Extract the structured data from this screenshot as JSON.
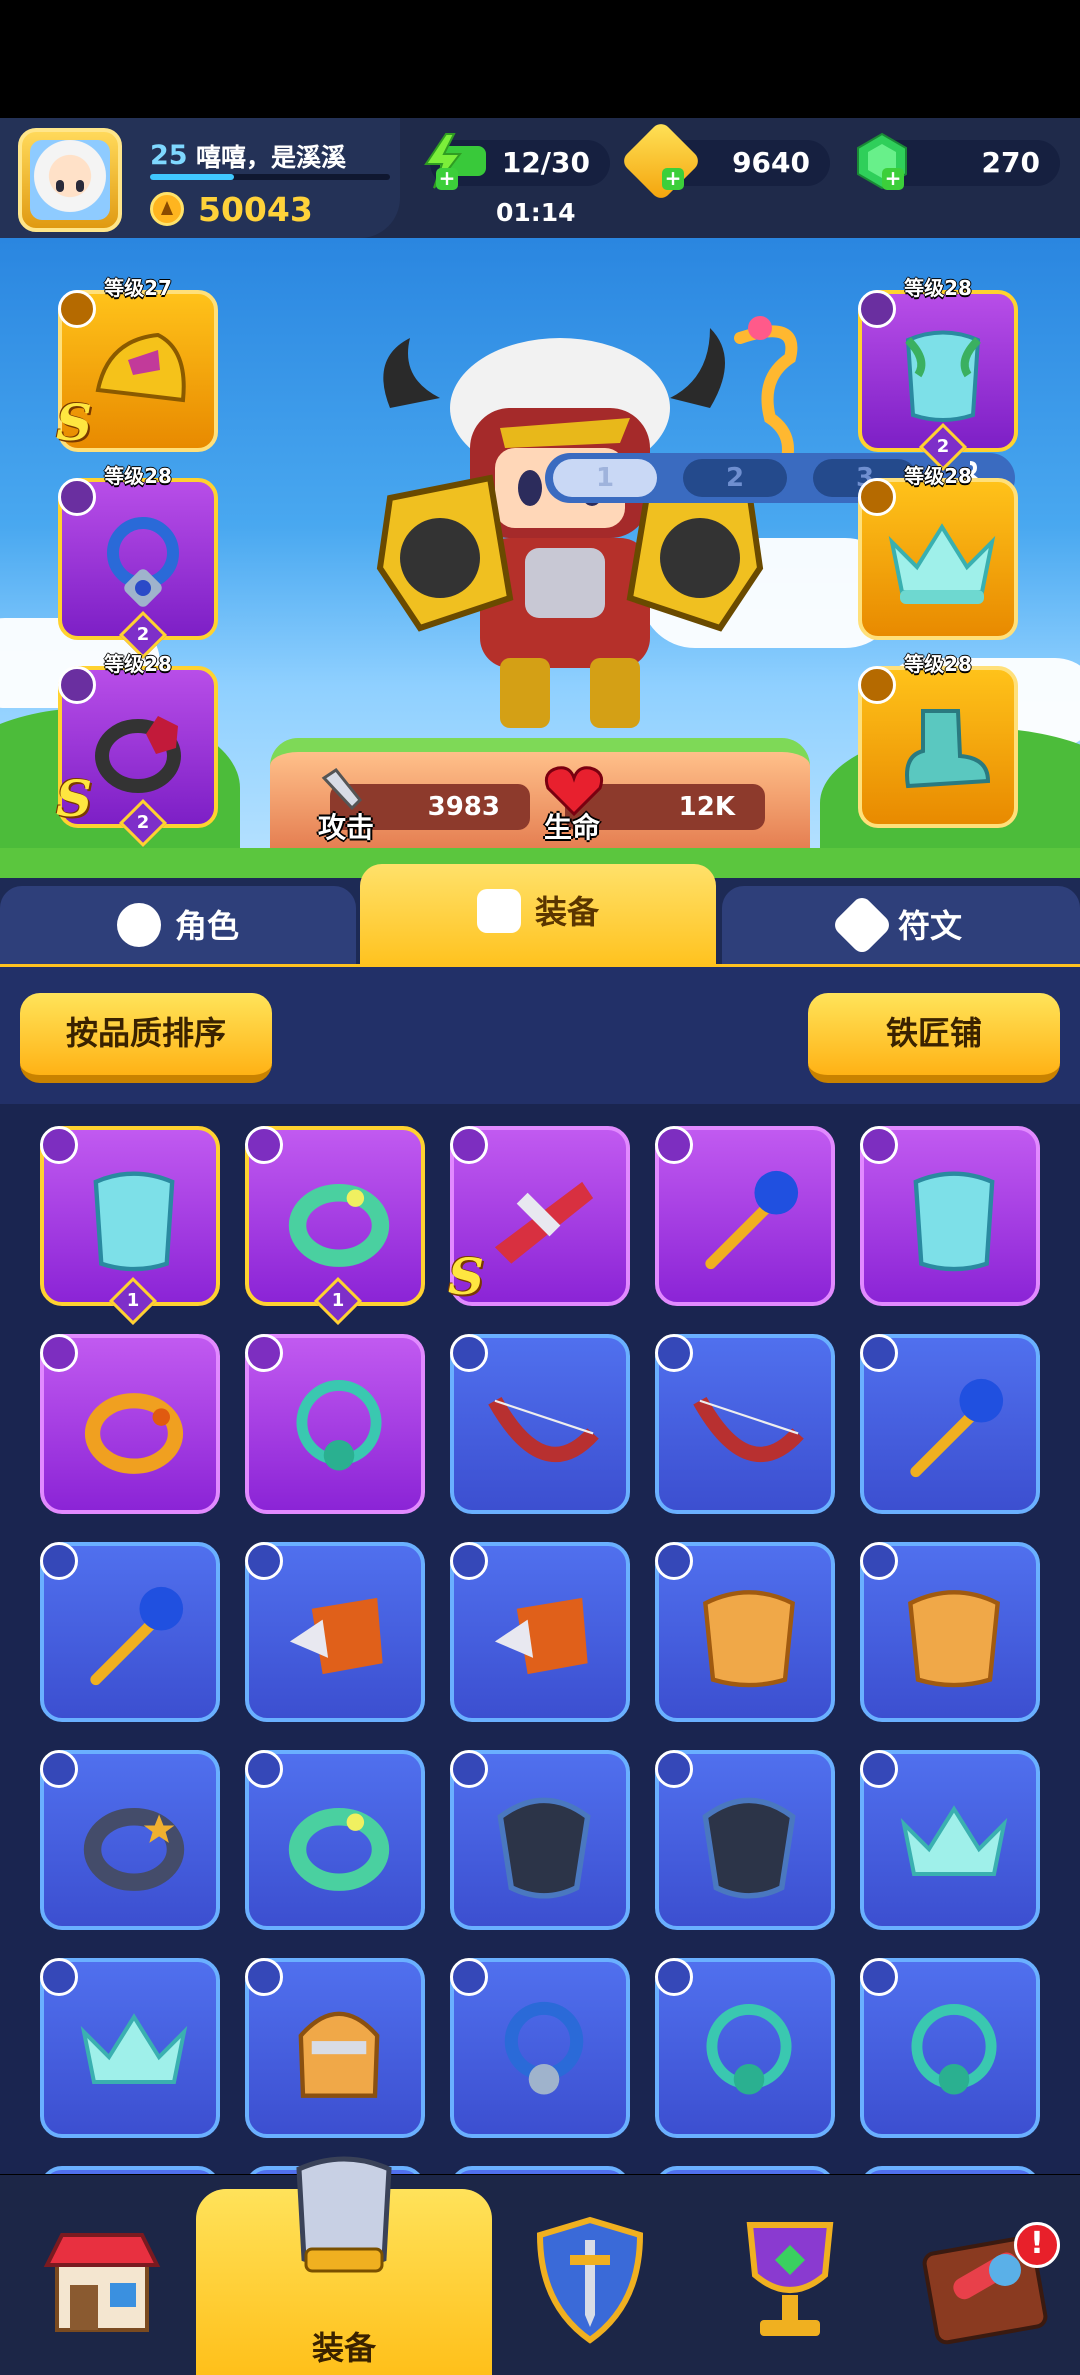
{
  "header": {
    "player_level": "25",
    "player_name": "嘻嘻，是溪溪",
    "xp_fraction": 0.35,
    "power": "50043",
    "energy": "12/30",
    "energy_timer": "01:14",
    "gold": "9640",
    "gems": "270"
  },
  "loadout_tabs": [
    "1",
    "2",
    "3"
  ],
  "active_loadout": "1",
  "equipped": {
    "weapon": {
      "level": "等级27",
      "rank": "S"
    },
    "necklace": {
      "level": "等级28",
      "count": "2"
    },
    "ring": {
      "level": "等级28",
      "rank": "S",
      "count": "2"
    },
    "armor": {
      "level": "等级28",
      "count": "2"
    },
    "helmet": {
      "level": "等级28"
    },
    "boots": {
      "level": "等级28"
    }
  },
  "stats": {
    "attack_label": "攻击",
    "attack_value": "3983",
    "hp_label": "生命",
    "hp_value": "12K"
  },
  "tabs": {
    "character": "角色",
    "equipment": "装备",
    "runes": "符文"
  },
  "toolbar": {
    "sort_label": "按品质排序",
    "blacksmith_label": "铁匠铺"
  },
  "inventory_counts": {
    "item_1": "1",
    "item_2": "1"
  },
  "inventory_ranks": {
    "item_3": "S"
  },
  "bottom_nav": {
    "active_label": "装备",
    "notification": "!"
  },
  "colors": {
    "epic": "#9b34dc",
    "rare": "#4560e0",
    "gold_frame": "#ffd230",
    "tab_active": "#ffc320"
  },
  "icons": {
    "energy": "lightning-icon",
    "gold": "gold-coin-icon",
    "gem": "emerald-icon",
    "hanger": "hanger-icon"
  }
}
